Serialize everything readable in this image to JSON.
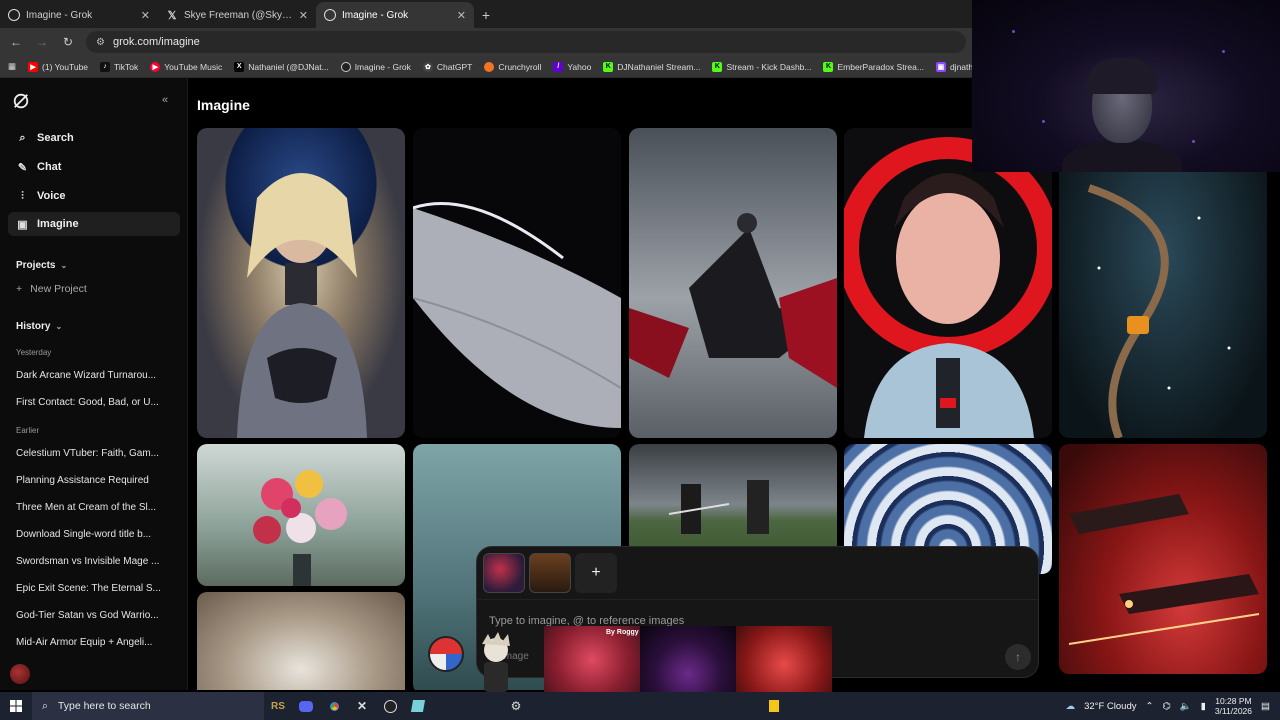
{
  "browser": {
    "tabs": [
      {
        "title": "Imagine - Grok",
        "active": false
      },
      {
        "title": "Skye Freeman (@Skyebrows) /",
        "active": false
      },
      {
        "title": "Imagine - Grok",
        "active": true
      }
    ],
    "url": "grok.com/imagine",
    "bookmarks": [
      {
        "label": "(1) YouTube",
        "color": "#ff0000"
      },
      {
        "label": "TikTok",
        "color": "#111111"
      },
      {
        "label": "YouTube Music",
        "color": "#ff0033"
      },
      {
        "label": "Nathaniel (@DJNat...",
        "color": "#000000"
      },
      {
        "label": "Imagine - Grok",
        "color": "#222222"
      },
      {
        "label": "ChatGPT",
        "color": "#444444"
      },
      {
        "label": "Crunchyroll",
        "color": "#f47521"
      },
      {
        "label": "Yahoo",
        "color": "#6001d2"
      },
      {
        "label": "DJNathaniel Stream...",
        "color": "#53fc18"
      },
      {
        "label": "Stream - Kick Dashb...",
        "color": "#53fc18"
      },
      {
        "label": "EmberParadox Strea...",
        "color": "#53fc18"
      },
      {
        "label": "djnathanielrs3 - Tw",
        "color": "#9146ff"
      }
    ]
  },
  "sidebar": {
    "nav": [
      {
        "label": "Search",
        "icon": "search-icon"
      },
      {
        "label": "Chat",
        "icon": "chat-icon"
      },
      {
        "label": "Voice",
        "icon": "voice-waveform-icon"
      },
      {
        "label": "Imagine",
        "icon": "imagine-icon",
        "active": true
      }
    ],
    "projects_label": "Projects",
    "new_project_label": "New Project",
    "history_label": "History",
    "yesterday_label": "Yesterday",
    "earlier_label": "Earlier",
    "history_yesterday": [
      "Dark Arcane Wizard Turnarou...",
      "First Contact: Good, Bad, or U..."
    ],
    "history_earlier": [
      "Celestium VTuber: Faith, Gam...",
      "Planning Assistance Required",
      "Three Men at Cream of the Sl...",
      "Download Single-word title b...",
      "Swordsman vs Invisible Mage ...",
      "Epic Exit Scene: The Eternal S...",
      "God-Tier Satan vs God Warrio...",
      "Mid-Air Armor Equip + Angeli..."
    ]
  },
  "main": {
    "title": "Imagine"
  },
  "composer": {
    "placeholder": "Type to imagine, @ to reference images",
    "mode_label": "Image",
    "add_label": "+"
  },
  "overlay": {
    "sticker_tag": "By Roggy"
  },
  "taskbar": {
    "search_placeholder": "Type here to search",
    "weather": "32°F  Cloudy",
    "time": "10:28 PM",
    "date": "3/11/2026"
  }
}
